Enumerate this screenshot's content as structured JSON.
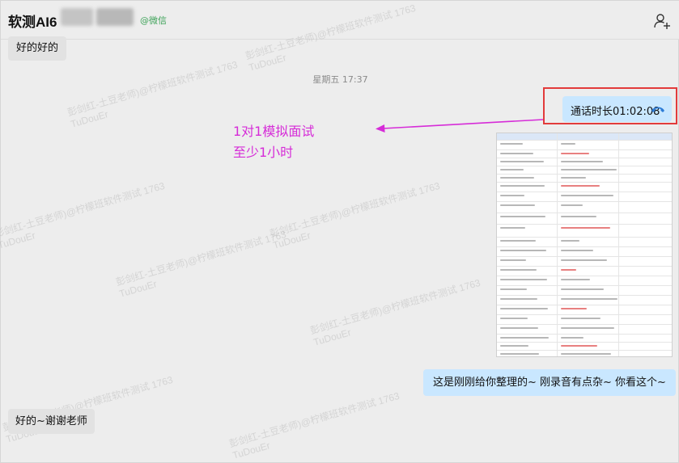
{
  "header": {
    "chat_name": "软测AI6",
    "wechat_tag": "@微信",
    "add_member_icon": "add-user-icon"
  },
  "messages": {
    "top_received": "好的好的",
    "time_separator": "星期五 17:37",
    "call": {
      "text": "通话时长01:02:08",
      "icon": "phone-hangup-icon"
    },
    "sent_text": "这是刚刚给你整理的~  刚录音有点杂~ 你看这个~",
    "bottom_received": "好的~谢谢老师"
  },
  "annotation": {
    "line1": "1对1模拟面试",
    "line2": "至少1小时"
  },
  "watermark": {
    "line1": "彭剑红-土豆老师)@柠檬班软件测试 1763",
    "line2": "TuDouEr"
  },
  "colors": {
    "received_bubble": "#e2e2e2",
    "sent_bubble": "#c9e7ff",
    "annotation": "#d62cd8",
    "highlight_box": "#e23b3b",
    "call_icon": "#2c7bd6",
    "wechat_tag": "#3fa35a"
  }
}
